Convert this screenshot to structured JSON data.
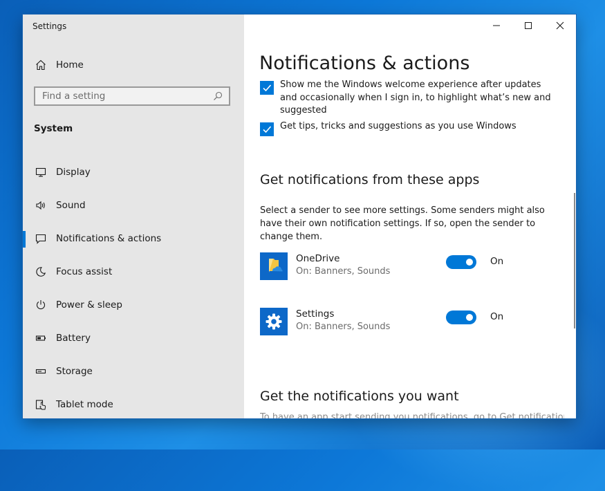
{
  "window": {
    "title": "Settings",
    "controls": [
      "minimize",
      "maximize",
      "close"
    ]
  },
  "sidebar": {
    "home_label": "Home",
    "search_placeholder": "Find a setting",
    "section_label": "System",
    "items": [
      {
        "label": "Display",
        "icon": "display-icon"
      },
      {
        "label": "Sound",
        "icon": "sound-icon"
      },
      {
        "label": "Notifications & actions",
        "icon": "notifications-icon",
        "selected": true
      },
      {
        "label": "Focus assist",
        "icon": "moon-icon"
      },
      {
        "label": "Power & sleep",
        "icon": "power-icon"
      },
      {
        "label": "Battery",
        "icon": "battery-icon"
      },
      {
        "label": "Storage",
        "icon": "storage-icon"
      },
      {
        "label": "Tablet mode",
        "icon": "tablet-mode-icon"
      }
    ]
  },
  "main": {
    "title": "Notifications & actions",
    "checkboxes": [
      {
        "label": "Show me the Windows welcome experience after updates and occasionally when I sign in, to highlight what’s new and suggested",
        "checked": true
      },
      {
        "label": "Get tips, tricks and suggestions as you use Windows",
        "checked": true
      }
    ],
    "apps_heading": "Get notifications from these apps",
    "apps_description": "Select a sender to see more settings. Some senders might also have their own notification settings. If so, open the sender to change them.",
    "apps": [
      {
        "name": "OneDrive",
        "detail": "On: Banners, Sounds",
        "toggle_state": "On",
        "on": true,
        "icon": "onedrive-icon"
      },
      {
        "name": "Settings",
        "detail": "On: Banners, Sounds",
        "toggle_state": "On",
        "on": true,
        "icon": "settings-gear-icon"
      }
    ],
    "want_heading": "Get the notifications you want",
    "want_text": "To have an app start sending you notifications, go to Get notifications"
  },
  "colors": {
    "accent": "#0078d7",
    "sidebar_bg": "#e6e6e6",
    "app_tile": "#0d68c8"
  }
}
